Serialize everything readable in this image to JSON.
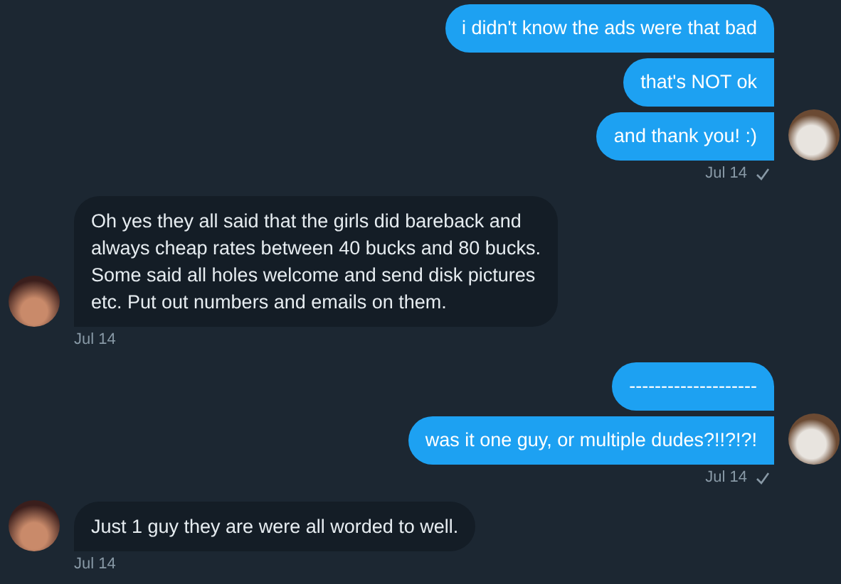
{
  "conversation": [
    {
      "kind": "sent",
      "messages": [
        "i didn't know the ads were that bad",
        "that's NOT ok",
        "and thank you! :)"
      ],
      "time": "Jul 14",
      "read": true
    },
    {
      "kind": "received",
      "messages": [
        "Oh yes they all said that the girls did bareback and always cheap rates between 40 bucks and 80 bucks. Some said all holes welcome and send disk pictures etc. Put out numbers and emails on them."
      ],
      "time": "Jul 14"
    },
    {
      "kind": "sent",
      "messages": [
        "--------------------",
        "was it one guy, or multiple dudes?!!?!?!"
      ],
      "time": "Jul 14",
      "read": true
    },
    {
      "kind": "received",
      "messages": [
        "Just 1 guy they are were all worded to well."
      ],
      "time": "Jul 14"
    }
  ]
}
